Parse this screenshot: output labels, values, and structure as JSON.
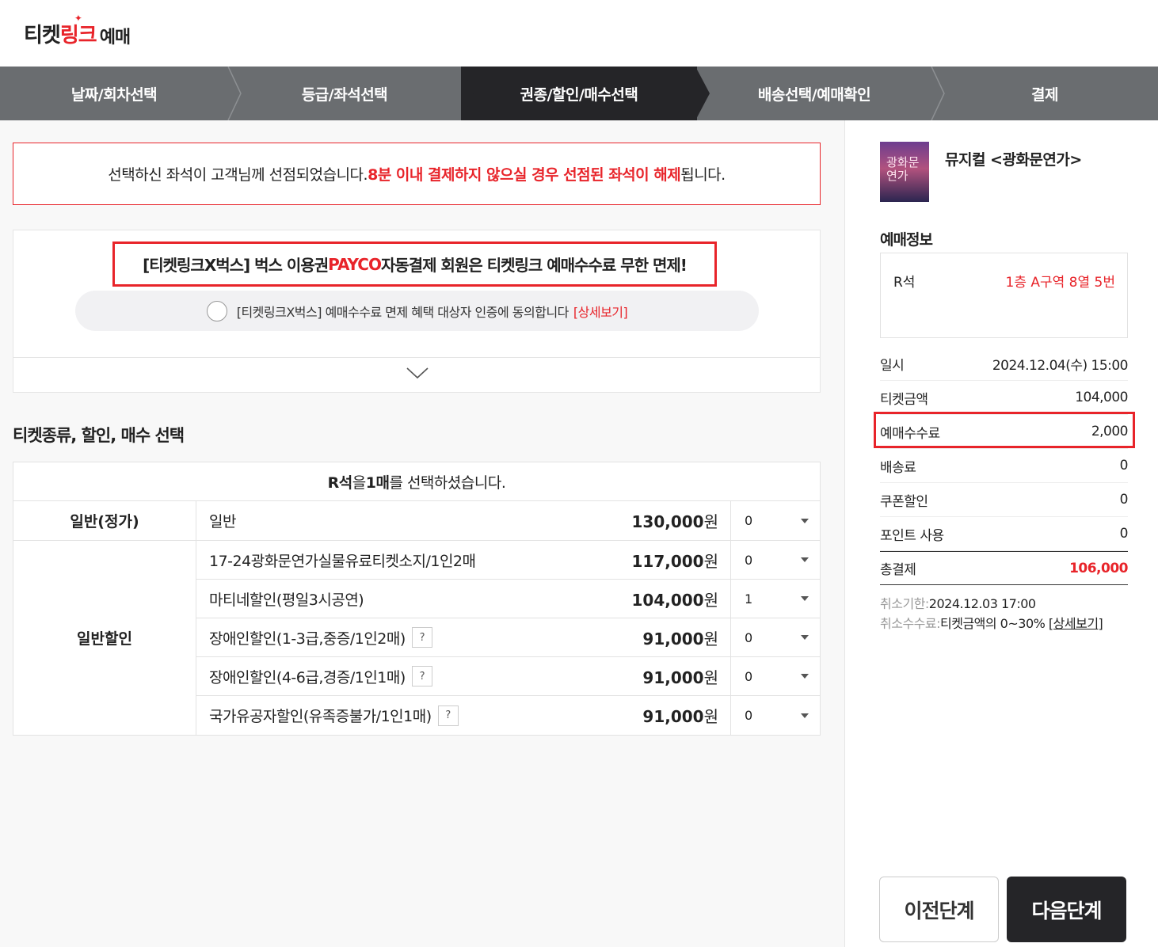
{
  "logo": {
    "part1": "티켓",
    "part2": "링크",
    "part3": "예매",
    "star": "✦"
  },
  "steps": [
    {
      "label": "날짜/회차선택",
      "active": false
    },
    {
      "label": "등급/좌석선택",
      "active": false
    },
    {
      "label": "권종/할인/매수선택",
      "active": true
    },
    {
      "label": "배송선택/예매확인",
      "active": false
    },
    {
      "label": "결제",
      "active": false
    }
  ],
  "notice": {
    "text": "선택하신 좌석이 고객님께 선점되었습니다. ",
    "highlight": "8분 이내 결제하지 않으실 경우 선점된 좌석이 해제",
    "tail": "됩니다."
  },
  "promo": {
    "title_a": "[티켓링크X벅스] 벅스 이용권 ",
    "title_b": "PAYCO",
    "title_c": " 자동결제 회원은 티켓링크 예매수수료 무한 면제!",
    "agree_text": "[티켓링크X벅스] 예매수수료 면제 혜택 대상자 인증에 동의합니다",
    "detail_link": "[상세보기]"
  },
  "section_title": "티켓종류, 할인, 매수 선택",
  "table": {
    "head_a": "R석",
    "head_b": "을 ",
    "head_c": "1매",
    "head_d": "를 선택하셨습니다.",
    "groups": [
      {
        "label": "일반(정가)",
        "rows": [
          {
            "name": "일반",
            "help": false,
            "price": "130,000",
            "unit": "원",
            "qty": "0"
          }
        ]
      },
      {
        "label": "일반할인",
        "rows": [
          {
            "name": "17-24광화문연가실물유료티켓소지/1인2매",
            "help": false,
            "price": "117,000",
            "unit": "원",
            "qty": "0"
          },
          {
            "name": "마티네할인(평일3시공연)",
            "help": false,
            "price": "104,000",
            "unit": "원",
            "qty": "1"
          },
          {
            "name": "장애인할인(1-3급,중증/1인2매)",
            "help": true,
            "price": "91,000",
            "unit": "원",
            "qty": "0"
          },
          {
            "name": "장애인할인(4-6급,경증/1인1매)",
            "help": true,
            "price": "91,000",
            "unit": "원",
            "qty": "0"
          },
          {
            "name": "국가유공자할인(유족증불가/1인1매)",
            "help": true,
            "price": "91,000",
            "unit": "원",
            "qty": "0"
          }
        ]
      }
    ],
    "help_glyph": "?"
  },
  "right": {
    "poster_text": "광화문\n연가",
    "show_title": "뮤지컬 <광화문연가>",
    "booking_label": "예매정보",
    "seat_grade": "R석",
    "seat_position": "1층 A구역 8열 5번",
    "info": [
      {
        "k": "일시",
        "v": "2024.12.04(수) 15:00"
      },
      {
        "k": "티켓금액",
        "v": "104,000"
      },
      {
        "k": "예매수수료",
        "v": "2,000"
      },
      {
        "k": "배송료",
        "v": "0"
      },
      {
        "k": "쿠폰할인",
        "v": "0"
      },
      {
        "k": "포인트 사용",
        "v": "0"
      },
      {
        "k": "총결제",
        "v": "106,000"
      }
    ],
    "cancel_deadline_k": "취소기한:",
    "cancel_deadline_v": "2024.12.03 17:00",
    "cancel_fee_k": "취소수수료:",
    "cancel_fee_v": "티켓금액의 0~30% ",
    "cancel_fee_link": "[상세보기]",
    "prev_button": "이전단계",
    "next_button": "다음단계"
  },
  "colors": {
    "accent": "#e8242a",
    "dark": "#252528",
    "step_bg": "#6a6d70"
  }
}
